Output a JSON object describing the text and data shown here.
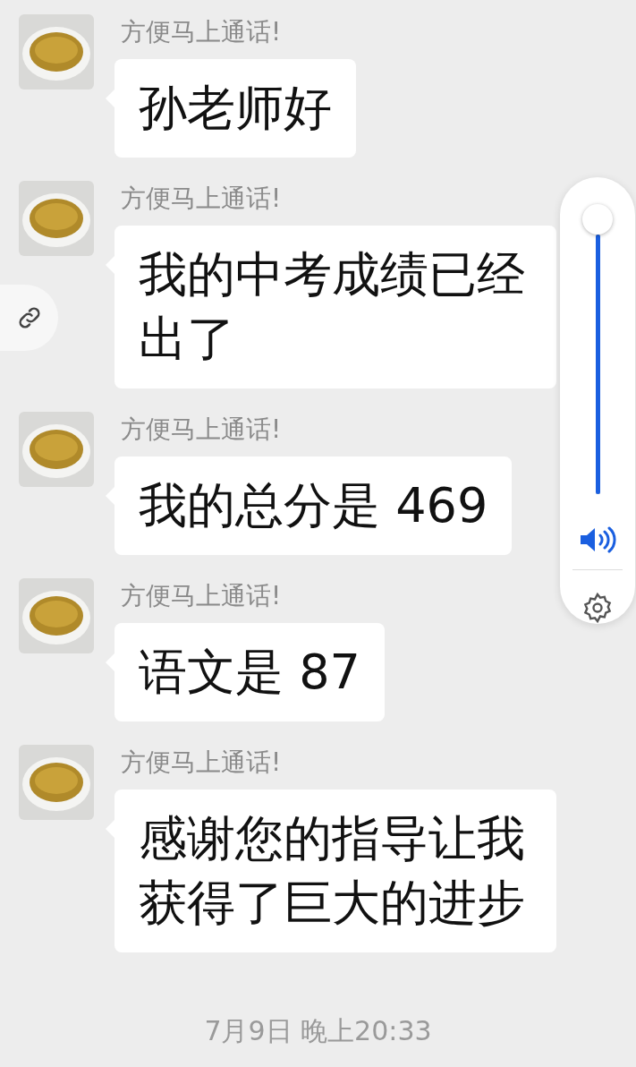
{
  "messages": [
    {
      "sender": "方便马上通话!",
      "text": "孙老师好"
    },
    {
      "sender": "方便马上通话!",
      "text": "我的中考成绩已经出了"
    },
    {
      "sender": "方便马上通话!",
      "text": "我的总分是 469"
    },
    {
      "sender": "方便马上通话!",
      "text": "语文是 87"
    },
    {
      "sender": "方便马上通话!",
      "text": "感谢您的指导让我获得了巨大的进步"
    }
  ],
  "timestamp": "7月9日 晚上20:33",
  "volume": {
    "level": 1
  }
}
